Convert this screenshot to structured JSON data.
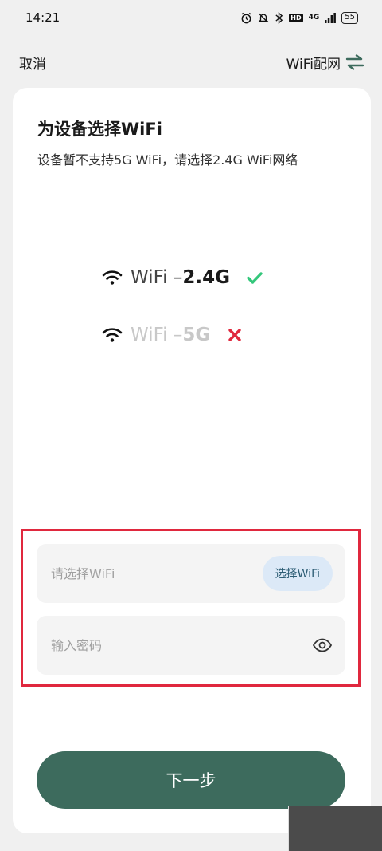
{
  "status_bar": {
    "time": "14:21",
    "network": "4G",
    "hd": "HD",
    "battery": "55"
  },
  "nav": {
    "cancel": "取消",
    "mode": "WiFi配网"
  },
  "card": {
    "title": "为设备选择WiFi",
    "subtitle": "设备暂不支持5G WiFi，请选择2.4G WiFi网络",
    "bands": [
      {
        "prefix": "WiFi – ",
        "band": "2.4G",
        "supported": true
      },
      {
        "prefix": "WiFi – ",
        "band": "5G",
        "supported": false
      }
    ],
    "wifi_field": {
      "placeholder": "请选择WiFi",
      "value": ""
    },
    "select_button": "选择WiFi",
    "password_field": {
      "placeholder": "输入密码",
      "value": ""
    },
    "next_button": "下一步"
  },
  "colors": {
    "accent": "#3d6b5d",
    "check": "#34c77b",
    "cross": "#e0283e",
    "highlight_border": "#e0283e",
    "pick_button_bg": "#dce9f7"
  }
}
